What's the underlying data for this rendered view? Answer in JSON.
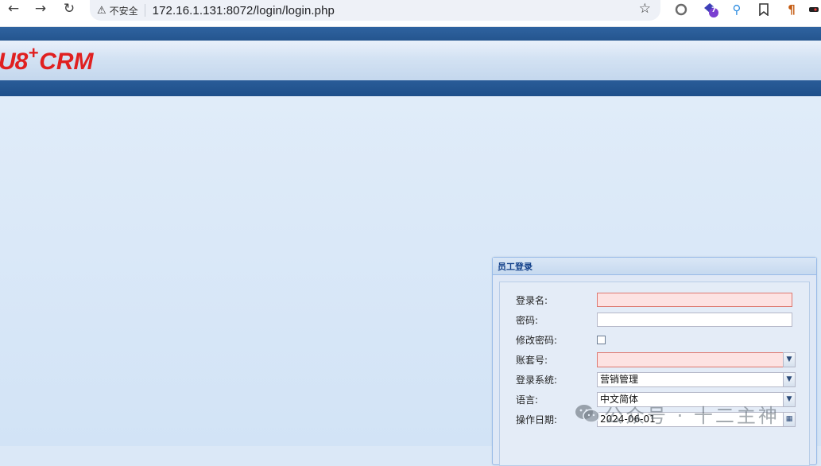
{
  "browser": {
    "security_label": "不安全",
    "url": "172.16.1.131:8072/login/login.php",
    "ext_badge": "7",
    "ext_text_icon": "¶"
  },
  "app": {
    "logo_part1": "U8",
    "logo_plus": "+",
    "logo_part2": "CRM",
    "logo_color": "#e02020",
    "header_color": "#2a5c98"
  },
  "login": {
    "title": "员工登录",
    "fields": {
      "username": {
        "label": "登录名:",
        "value": ""
      },
      "password": {
        "label": "密码:",
        "value": ""
      },
      "change_password": {
        "label": "修改密码:",
        "checked": false
      },
      "account_set": {
        "label": "账套号:",
        "value": ""
      },
      "system": {
        "label": "登录系统:",
        "value": "营销管理"
      },
      "language": {
        "label": "语言:",
        "value": "中文简体"
      },
      "date": {
        "label": "操作日期:",
        "value": "2024-06-01"
      }
    }
  },
  "watermark": {
    "text": "公众号 · 十二主神"
  }
}
